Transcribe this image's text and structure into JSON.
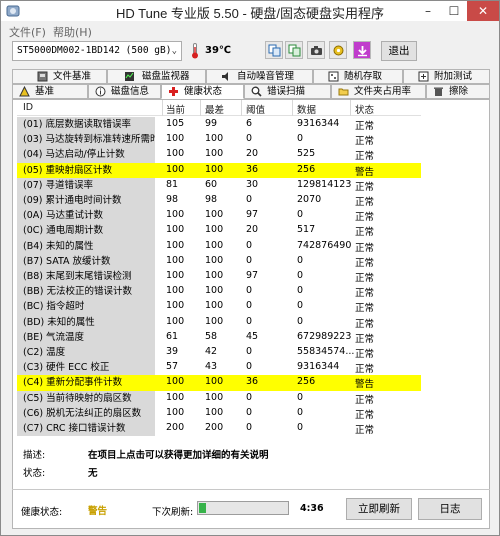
{
  "window": {
    "title": "HD Tune 专业版 5.50 - 硬盘/固态硬盘实用程序",
    "minimize": "–",
    "maximize": "☐",
    "close": "✕"
  },
  "menu": [
    {
      "label": "文件(F)"
    },
    {
      "label": "帮助(H)"
    }
  ],
  "toolbar": {
    "drive": "ST5000DM002-1BD142 (500 gB)",
    "temperature": "39℃",
    "exit_label": "退出",
    "buttons": [
      "copy-icon",
      "copy-all-icon",
      "camera-icon",
      "options-icon",
      "save-icon"
    ]
  },
  "tabs": {
    "row1": [
      {
        "label": "文件基准"
      },
      {
        "label": "磁盘监视器"
      },
      {
        "label": "自动噪音管理"
      },
      {
        "label": "随机存取"
      },
      {
        "label": "附加测试"
      }
    ],
    "row2": [
      {
        "label": "基准"
      },
      {
        "label": "磁盘信息"
      },
      {
        "label": "健康状态"
      },
      {
        "label": "错误扫描"
      },
      {
        "label": "文件夹占用率"
      },
      {
        "label": "擦除"
      }
    ],
    "active": "健康状态"
  },
  "table": {
    "columns": [
      "ID",
      "当前",
      "最差",
      "阈值",
      "数据",
      "状态"
    ],
    "rows": [
      {
        "id": "(01) 底层数据读取错误率",
        "current": "105",
        "worst": "99",
        "threshold": "6",
        "data": "9316344",
        "status": "正常",
        "warn": false
      },
      {
        "id": "(03) 马达旋转到标准转速所需时间",
        "current": "100",
        "worst": "100",
        "threshold": "0",
        "data": "0",
        "status": "正常",
        "warn": false
      },
      {
        "id": "(04) 马达启动/停止计数",
        "current": "100",
        "worst": "100",
        "threshold": "20",
        "data": "525",
        "status": "正常",
        "warn": false
      },
      {
        "id": "(05) 重映射扇区计数",
        "current": "100",
        "worst": "100",
        "threshold": "36",
        "data": "256",
        "status": "警告",
        "warn": true
      },
      {
        "id": "(07) 寻道错误率",
        "current": "81",
        "worst": "60",
        "threshold": "30",
        "data": "129814123",
        "status": "正常",
        "warn": false
      },
      {
        "id": "(09) 累计通电时间计数",
        "current": "98",
        "worst": "98",
        "threshold": "0",
        "data": "2070",
        "status": "正常",
        "warn": false
      },
      {
        "id": "(0A) 马达重试计数",
        "current": "100",
        "worst": "100",
        "threshold": "97",
        "data": "0",
        "status": "正常",
        "warn": false
      },
      {
        "id": "(0C) 通电周期计数",
        "current": "100",
        "worst": "100",
        "threshold": "20",
        "data": "517",
        "status": "正常",
        "warn": false
      },
      {
        "id": "(B4) 未知的属性",
        "current": "100",
        "worst": "100",
        "threshold": "0",
        "data": "742876490",
        "status": "正常",
        "warn": false
      },
      {
        "id": "(B7) SATA 放缓计数",
        "current": "100",
        "worst": "100",
        "threshold": "0",
        "data": "0",
        "status": "正常",
        "warn": false
      },
      {
        "id": "(B8) 末尾到末尾错误检测",
        "current": "100",
        "worst": "100",
        "threshold": "97",
        "data": "0",
        "status": "正常",
        "warn": false
      },
      {
        "id": "(BB) 无法校正的错误计数",
        "current": "100",
        "worst": "100",
        "threshold": "0",
        "data": "0",
        "status": "正常",
        "warn": false
      },
      {
        "id": "(BC) 指令超时",
        "current": "100",
        "worst": "100",
        "threshold": "0",
        "data": "0",
        "status": "正常",
        "warn": false
      },
      {
        "id": "(BD) 未知的属性",
        "current": "100",
        "worst": "100",
        "threshold": "0",
        "data": "0",
        "status": "正常",
        "warn": false
      },
      {
        "id": "(BE) 气流温度",
        "current": "61",
        "worst": "58",
        "threshold": "45",
        "data": "672989223",
        "status": "正常",
        "warn": false
      },
      {
        "id": "(C2) 温度",
        "current": "39",
        "worst": "42",
        "threshold": "0",
        "data": "55834574...",
        "status": "正常",
        "warn": false
      },
      {
        "id": "(C3) 硬件 ECC 校正",
        "current": "57",
        "worst": "43",
        "threshold": "0",
        "data": "9316344",
        "status": "正常",
        "warn": false
      },
      {
        "id": "(C4) 重新分配事件计数",
        "current": "100",
        "worst": "100",
        "threshold": "36",
        "data": "256",
        "status": "警告",
        "warn": true
      },
      {
        "id": "(C5) 当前待映射的扇区数",
        "current": "100",
        "worst": "100",
        "threshold": "0",
        "data": "0",
        "status": "正常",
        "warn": false
      },
      {
        "id": "(C6) 脱机无法纠正的扇区数",
        "current": "100",
        "worst": "100",
        "threshold": "0",
        "data": "0",
        "status": "正常",
        "warn": false
      },
      {
        "id": "(C7) CRC 接口错误计数",
        "current": "200",
        "worst": "200",
        "threshold": "0",
        "data": "0",
        "status": "正常",
        "warn": false
      }
    ]
  },
  "description": {
    "label": "描述:",
    "value": "在项目上点击可以获得更加详细的有关说明",
    "status_label": "状态:",
    "status_value": "无"
  },
  "footer": {
    "health_label": "健康状态:",
    "health_value": "警告",
    "health_color": "#c8a000",
    "next_refresh_label": "下次刷新:",
    "countdown": "4:36",
    "refresh_progress": 0.08,
    "refresh_now_label": "立即刷新",
    "log_label": "日志"
  },
  "colors": {
    "warn_row": "#ffff00",
    "progress": "#37b34a",
    "close_button": "#c94a47"
  }
}
